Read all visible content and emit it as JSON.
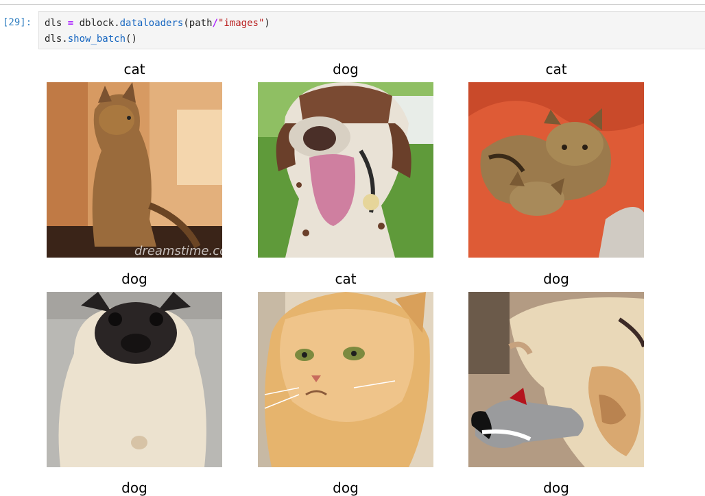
{
  "cell": {
    "prompt": "[29]:",
    "line1": {
      "var": "dls",
      "op": "=",
      "obj": "dblock",
      "method": "dataloaders",
      "arg": "path",
      "div": "/",
      "string": "\"images\"",
      "close": ")"
    },
    "line2": {
      "var": "dls",
      "method": "show_batch",
      "call": "()"
    }
  },
  "batch": {
    "labels": [
      "cat",
      "dog",
      "cat",
      "dog",
      "cat",
      "dog",
      "dog",
      "dog",
      "dog"
    ]
  },
  "watermark": "dreamstime.com"
}
